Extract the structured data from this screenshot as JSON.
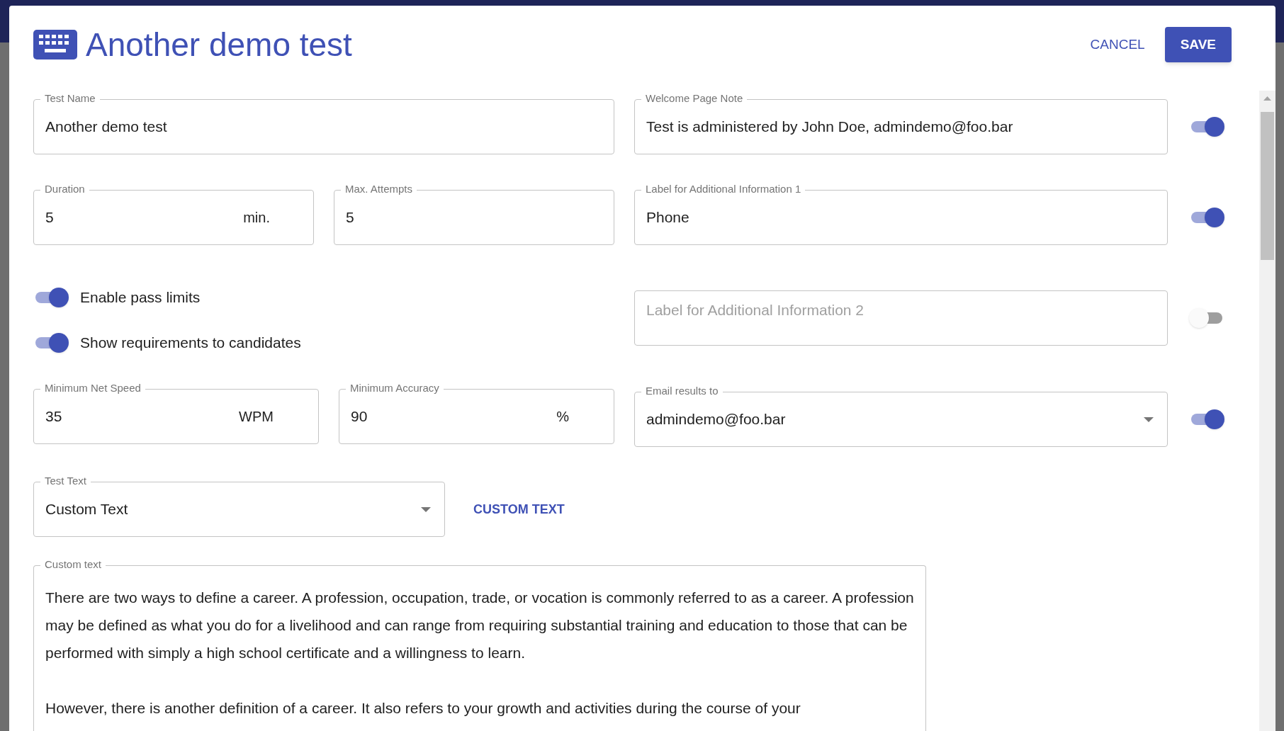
{
  "dialog": {
    "title": "Another demo test",
    "actions": [
      {
        "label": "CANCEL",
        "kind": "text"
      },
      {
        "label": "SAVE",
        "kind": "contained"
      }
    ]
  },
  "test_name": {
    "label": "Test Name",
    "value": "Another demo test"
  },
  "duration": {
    "label": "Duration",
    "value": "5",
    "suffix": "min."
  },
  "max_attempts": {
    "label": "Max. Attempts",
    "value": "5"
  },
  "switches": [
    {
      "label": "Enable pass limits",
      "on": true
    },
    {
      "label": "Show requirements to candidates",
      "on": true
    }
  ],
  "min_net_speed": {
    "label": "Minimum Net Speed",
    "value": "35",
    "suffix": "WPM"
  },
  "min_accuracy": {
    "label": "Minimum Accuracy",
    "value": "90",
    "suffix": "%"
  },
  "right_fields": [
    {
      "kind": "text",
      "label": "Welcome Page Note",
      "value": "Test is administered by John Doe, admindemo@foo.bar",
      "on": true
    },
    {
      "kind": "text",
      "label": "Label for Additional Information 1",
      "value": "Phone",
      "on": true
    },
    {
      "kind": "empty",
      "placeholder": "Label for Additional Information 2",
      "on": false
    },
    {
      "kind": "select",
      "label": "Email results to",
      "value": "admindemo@foo.bar",
      "on": true
    }
  ],
  "test_text": {
    "label": "Test Text",
    "value": "Custom Text",
    "link": "CUSTOM TEXT"
  },
  "custom_text": {
    "label": "Custom text",
    "paragraphs": [
      "There are two ways to define a career. A profession, occupation, trade, or vocation is commonly referred to as a career. A profession may be defined as what you do for a livelihood and can range from requiring substantial training and education to those that can be performed with simply a high school certificate and a willingness to learn.",
      "However, there is another definition of a career. It also refers to your growth and activities during the course of your"
    ]
  }
}
